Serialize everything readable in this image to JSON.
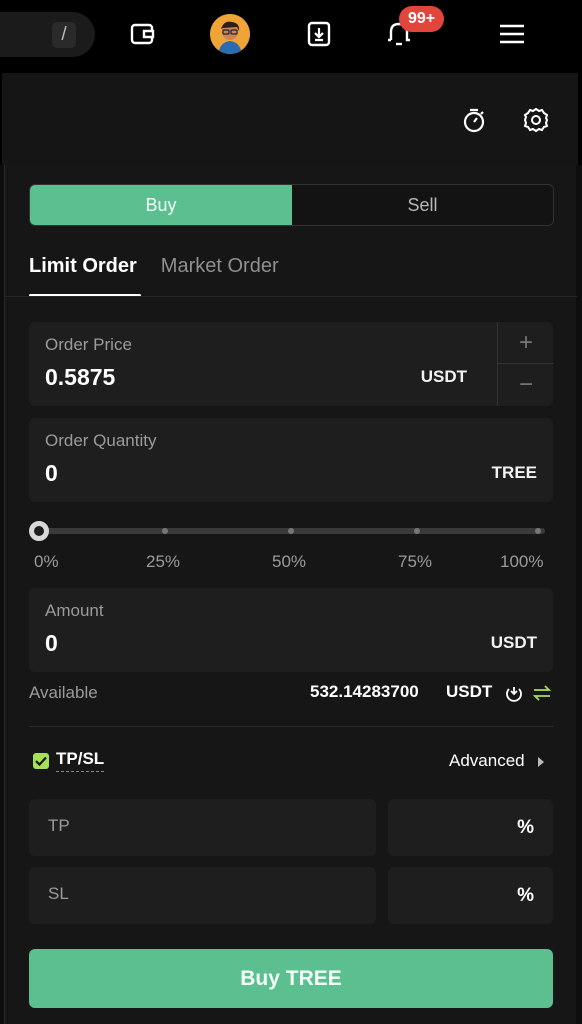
{
  "topbar": {
    "search_shortcut": "/",
    "notification_badge": "99+",
    "icons": [
      "wallet-icon",
      "avatar",
      "download-icon",
      "bell-icon",
      "menu-icon"
    ]
  },
  "subheader": {
    "icons": [
      "stopwatch-icon",
      "settings-gear-icon"
    ]
  },
  "side_toggle": {
    "buy_label": "Buy",
    "sell_label": "Sell",
    "selected": "Buy"
  },
  "order_tabs": {
    "limit_label": "Limit Order",
    "market_label": "Market Order",
    "selected": "Limit Order"
  },
  "order_price": {
    "label": "Order Price",
    "value": "0.5875",
    "unit": "USDT",
    "plus": "+",
    "minus": "−"
  },
  "order_quantity": {
    "label": "Order Quantity",
    "value": "0",
    "unit": "TREE"
  },
  "slider": {
    "value_percent": 0,
    "marks": [
      "0%",
      "25%",
      "50%",
      "75%",
      "100%"
    ]
  },
  "amount": {
    "label": "Amount",
    "value": "0",
    "unit": "USDT"
  },
  "available": {
    "label": "Available",
    "value": "532.14283700",
    "unit": "USDT"
  },
  "tpsl": {
    "label": "TP/SL",
    "checked": true,
    "advanced_label": "Advanced",
    "tp_label": "TP",
    "sl_label": "SL",
    "pct_symbol": "%"
  },
  "submit": {
    "label": "Buy TREE"
  },
  "colors": {
    "buy_green": "#5bbf8f",
    "checkbox_green": "#a6e05a",
    "badge_red": "#e2453b",
    "panel_bg": "#161616",
    "field_bg": "#1e1e1e"
  }
}
